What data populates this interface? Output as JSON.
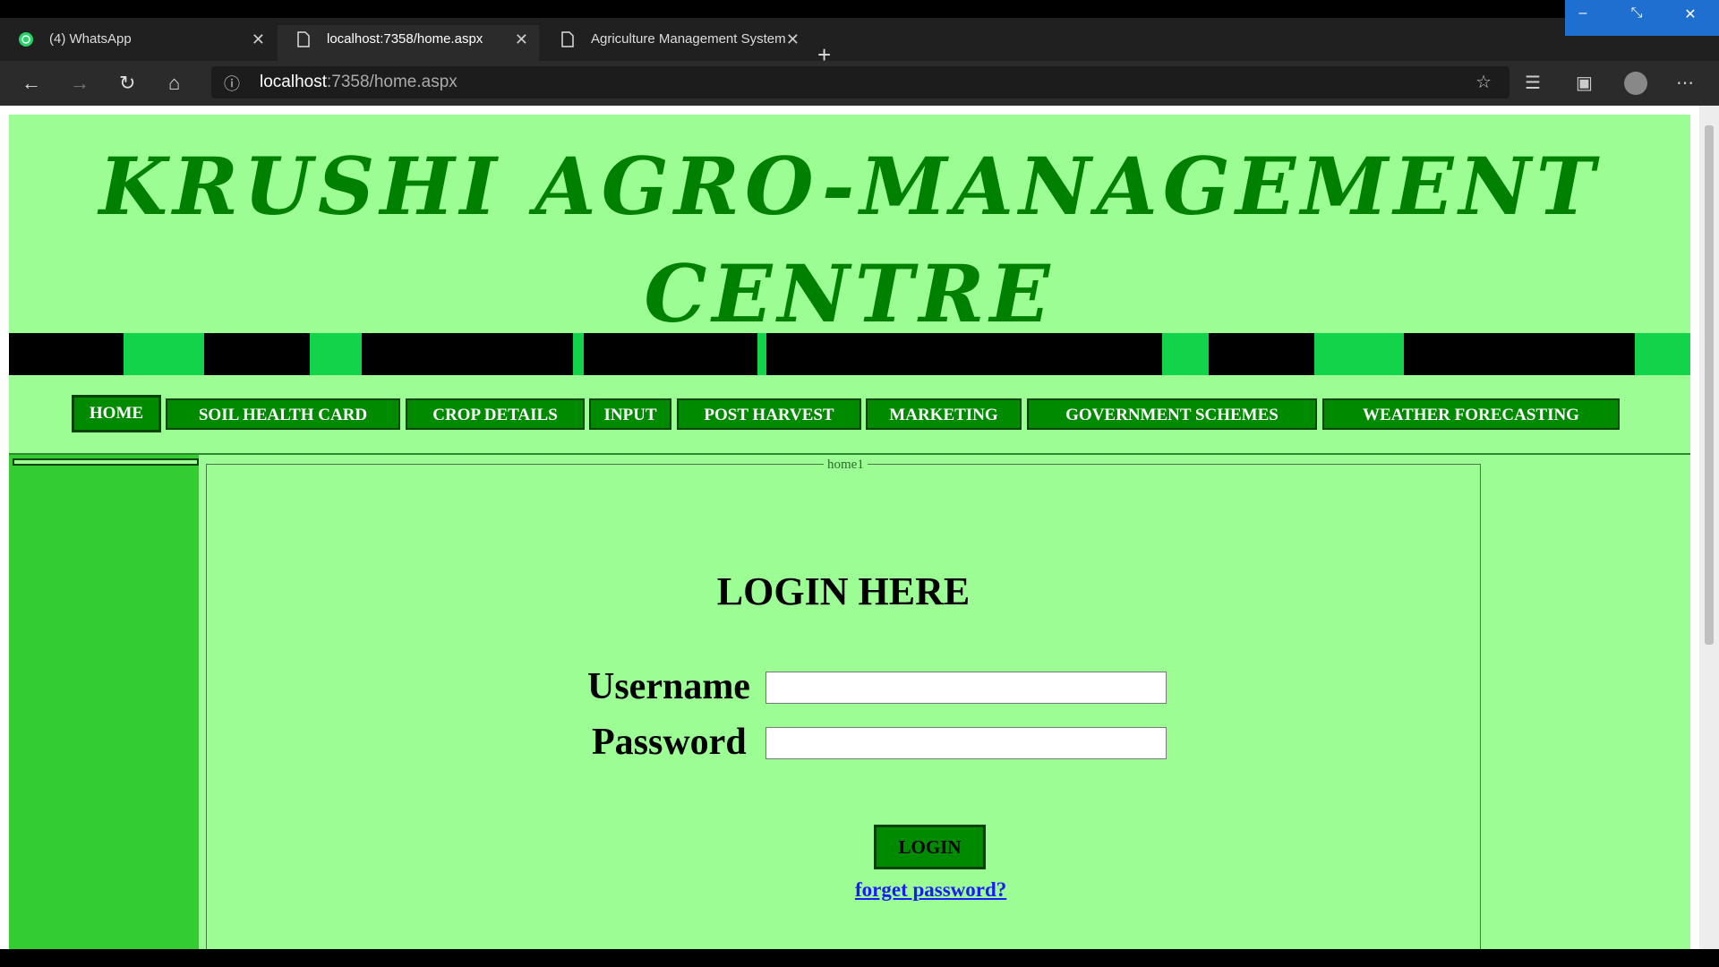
{
  "browser": {
    "tabs": [
      {
        "title": "(4) WhatsApp",
        "icon": "whatsapp-icon"
      },
      {
        "title": "localhost:7358/home.aspx",
        "icon": "page-icon"
      },
      {
        "title": "Agriculture Management System",
        "icon": "page-icon"
      }
    ],
    "url_host": "localhost",
    "url_path": ":7358/home.aspx"
  },
  "site": {
    "title": "KRUSHI AGRO-MANAGEMENT CENTRE"
  },
  "nav": {
    "items": [
      "HOME",
      "SOIL HEALTH CARD",
      "CROP DETAILS",
      "INPUT",
      "POST HARVEST",
      "MARKETING",
      "GOVERNMENT SCHEMES",
      "WEATHER FORECASTING"
    ]
  },
  "login": {
    "legend": "home1",
    "heading": "LOGIN HERE",
    "username_label": "Username",
    "password_label": "Password",
    "username_value": "",
    "password_value": "",
    "button_label": "LOGIN",
    "forgot_link": "forget password?"
  },
  "colors": {
    "page_bg": "#9cfd94",
    "nav_button": "#008a00",
    "title": "#008000",
    "sidebar": "#33cc33",
    "banner_accent": "#11d44a"
  }
}
